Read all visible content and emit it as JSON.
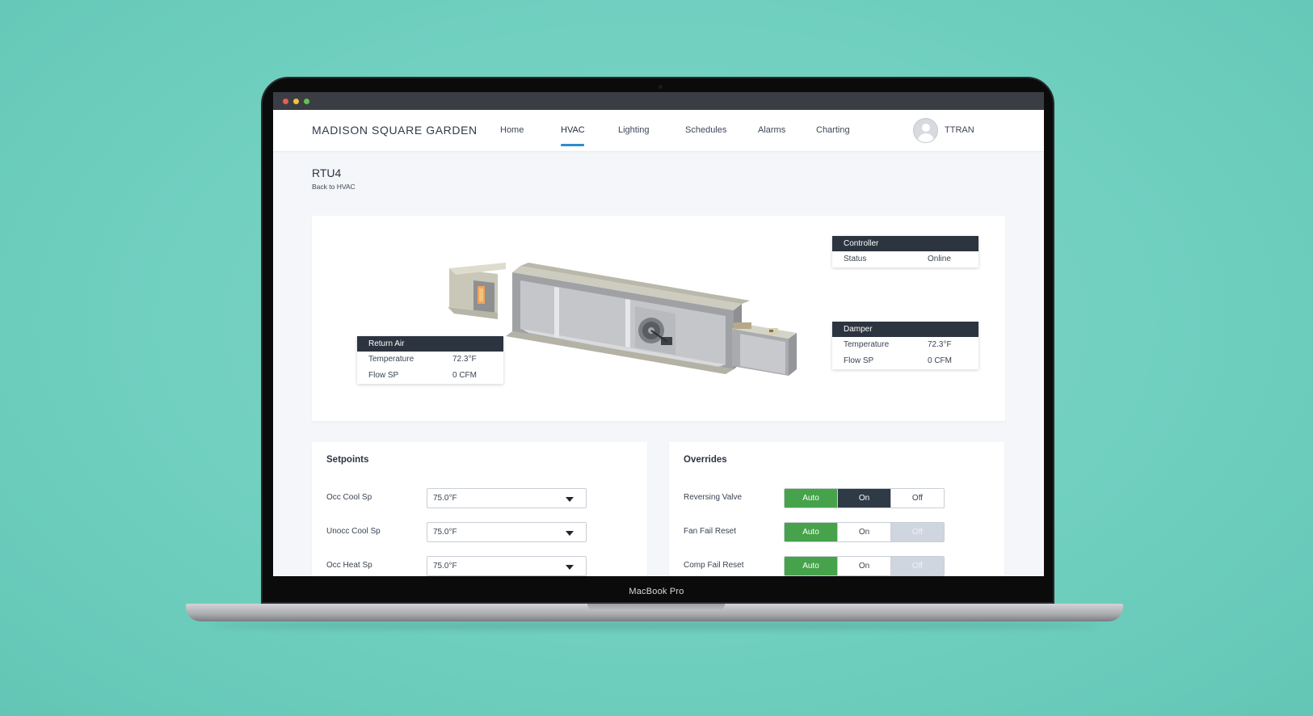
{
  "device": {
    "label": "MacBook Pro"
  },
  "app": {
    "logo": "MADISON SQUARE GARDEN"
  },
  "nav": {
    "items": [
      {
        "label": "Home"
      },
      {
        "label": "HVAC",
        "active": true
      },
      {
        "label": "Lighting"
      },
      {
        "label": "Schedules"
      },
      {
        "label": "Alarms"
      },
      {
        "label": "Charting"
      }
    ],
    "user": "TTRAN"
  },
  "page": {
    "title": "RTU4",
    "back": "Back to HVAC"
  },
  "equipment": {
    "controller": {
      "title": "Controller",
      "rows": [
        {
          "k": "Status",
          "v": "Online"
        }
      ]
    },
    "damper": {
      "title": "Damper",
      "rows": [
        {
          "k": "Temperature",
          "v": "72.3°F"
        },
        {
          "k": "Flow SP",
          "v": "0 CFM"
        }
      ]
    },
    "return_air": {
      "title": "Return Air",
      "rows": [
        {
          "k": "Temperature",
          "v": "72.3°F"
        },
        {
          "k": "Flow SP",
          "v": "0 CFM"
        }
      ]
    }
  },
  "setpoints": {
    "title": "Setpoints",
    "rows": [
      {
        "label": "Occ Cool Sp",
        "value": "75.0°F"
      },
      {
        "label": "Unocc Cool Sp",
        "value": "75.0°F"
      },
      {
        "label": "Occ Heat Sp",
        "value": "75.0°F"
      }
    ]
  },
  "overrides": {
    "title": "Overrides",
    "options": [
      "Auto",
      "On",
      "Off"
    ],
    "rows": [
      {
        "label": "Reversing Valve",
        "selected": "On"
      },
      {
        "label": "Fan Fail Reset",
        "selected": "Auto"
      },
      {
        "label": "Comp Fail Reset",
        "selected": "Auto"
      }
    ]
  },
  "colors": {
    "accent": "#2e8ccf",
    "auto_green": "#46a34b",
    "dark_header": "#2c3440",
    "background_teal": "#73d2c3"
  }
}
